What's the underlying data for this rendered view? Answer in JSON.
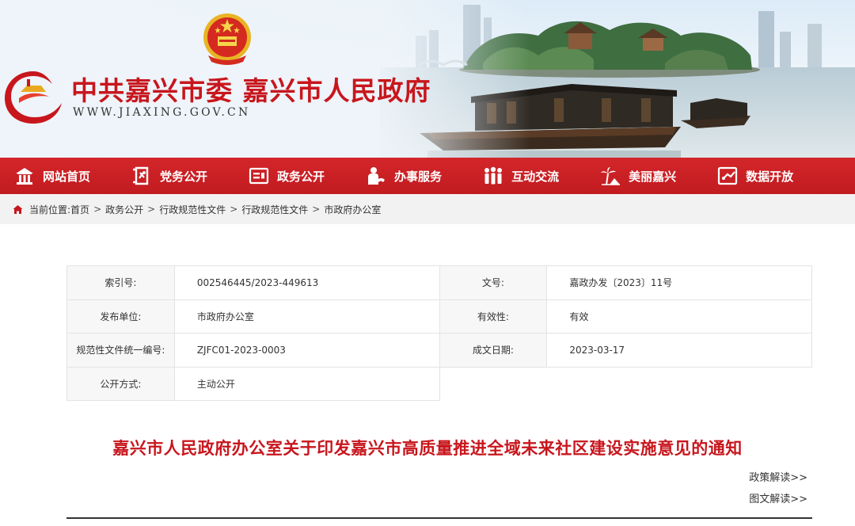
{
  "header": {
    "site_title": "中共嘉兴市委 嘉兴市人民政府",
    "site_url": "WWW.JIAXING.GOV.CN",
    "accent": "#c8161d"
  },
  "nav": {
    "items": [
      {
        "label": "网站首页",
        "icon": "home-icon"
      },
      {
        "label": "党务公开",
        "icon": "party-document-icon"
      },
      {
        "label": "政务公开",
        "icon": "gov-affairs-icon"
      },
      {
        "label": "办事服务",
        "icon": "service-hand-icon"
      },
      {
        "label": "互动交流",
        "icon": "people-interaction-icon"
      },
      {
        "label": "美丽嘉兴",
        "icon": "palm-scenery-icon"
      },
      {
        "label": "数据开放",
        "icon": "data-open-icon"
      }
    ],
    "background": "#c8161d"
  },
  "breadcrumb": {
    "prefix": "当前位置:",
    "items": [
      "首页",
      "政务公开",
      "行政规范性文件",
      "行政规范性文件",
      "市政府办公室"
    ],
    "separator": ">"
  },
  "info": {
    "index_label": "索引号:",
    "index_value": "002546445/2023-449613",
    "doc_no_label": "文号:",
    "doc_no_value": "嘉政办发〔2023〕11号",
    "issuer_label": "发布单位:",
    "issuer_value": "市政府办公室",
    "validity_label": "有效性:",
    "validity_value": "有效",
    "code_label": "规范性文件统一编号:",
    "code_value": "ZJFC01-2023-0003",
    "date_label": "成文日期:",
    "date_value": "2023-03-17",
    "disclosure_label": "公开方式:",
    "disclosure_value": "主动公开"
  },
  "document": {
    "title": "嘉兴市人民政府办公室关于印发嘉兴市高质量推进全域未来社区建设实施意见的通知",
    "policy_reading": "政策解读>>",
    "graphic_reading": "图文解读>>"
  }
}
